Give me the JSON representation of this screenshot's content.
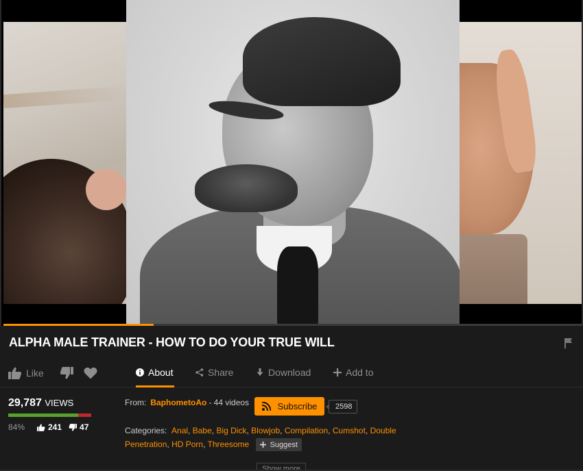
{
  "video": {
    "title": "ALPHA MALE TRAINER - HOW TO DO YOUR TRUE WILL",
    "progress_fraction": 0.26
  },
  "actions": {
    "like": "Like",
    "about": "About",
    "share": "Share",
    "download": "Download",
    "add_to": "Add to"
  },
  "stats": {
    "views": "29,787",
    "views_unit": "VIEWS",
    "rating_percent": "84%",
    "rating_fraction": 0.84,
    "likes": "241",
    "dislikes": "47"
  },
  "uploader": {
    "from_label": "From:",
    "name": "BaphometoAo",
    "video_count": "- 44 videos",
    "subscribe_label": "Subscribe",
    "subscriber_count": "2598"
  },
  "categories": {
    "label": "Categories:",
    "items": [
      "Anal",
      "Babe",
      "Big Dick",
      "Blowjob",
      "Compilation",
      "Cumshot",
      "Double Penetration",
      "HD Porn",
      "Threesome"
    ],
    "suggest_label": "Suggest"
  },
  "show_more": "Show more",
  "colors": {
    "accent": "#ff9000",
    "background": "#1b1b1b",
    "rating_good": "#57a12c",
    "rating_bad": "#c1272d"
  }
}
